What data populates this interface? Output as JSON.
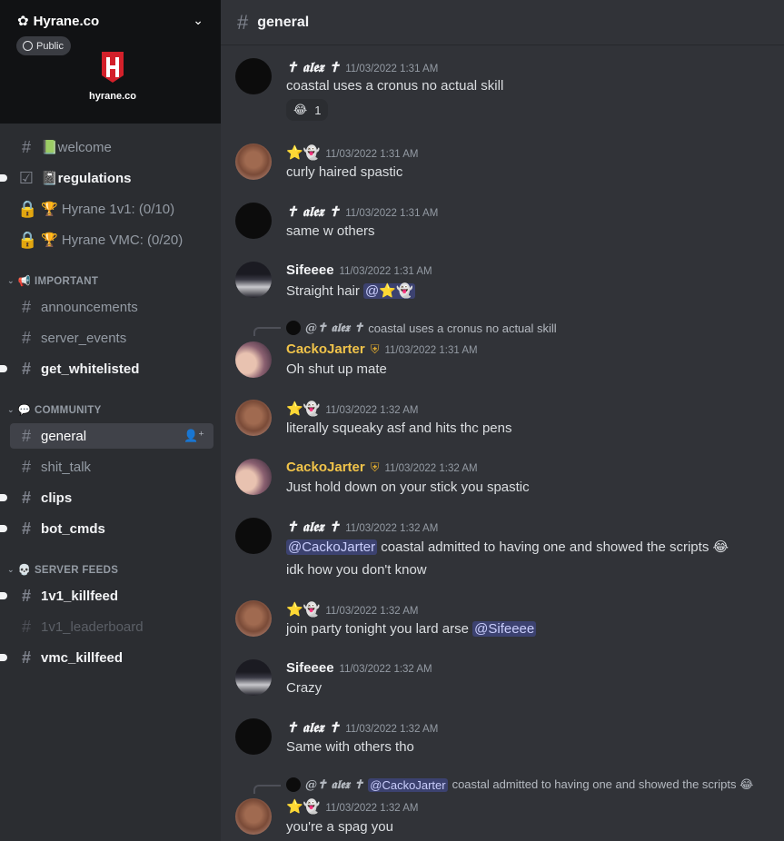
{
  "server": {
    "name": "Hyrane.co",
    "public_label": "Public",
    "logo_text": "hyrane.co"
  },
  "channels_top": [
    {
      "label": "📗welcome",
      "icon": "hash-icon"
    },
    {
      "label": "📓regulations",
      "icon": "rules-icon"
    },
    {
      "label": "🏆 Hyrane 1v1: (0/10)",
      "icon": "lock-icon"
    },
    {
      "label": "🏆 Hyrane VMC: (0/20)",
      "icon": "lock-icon"
    }
  ],
  "categories": {
    "important": "📢 IMPORTANT",
    "community": "💬 COMMUNITY",
    "server_feeds": "💀 SERVER FEEDS"
  },
  "channels_important": [
    "announcements",
    "server_events",
    "get_whitelisted"
  ],
  "channels_community": [
    "general",
    "shit_talk",
    "clips",
    "bot_cmds"
  ],
  "channels_feeds": [
    "1v1_killfeed",
    "1v1_leaderboard",
    "vmc_killfeed"
  ],
  "header": {
    "channel": "general"
  },
  "messages": [
    {
      "user": "✝ 𝖆𝖑𝖊𝖝 ✝",
      "time": "11/03/2022 1:31 AM",
      "text": "coastal uses a cronus no actual skill",
      "reaction_emoji": "😂",
      "reaction_count": "1"
    },
    {
      "user": "⭐👻",
      "time": "11/03/2022 1:31 AM",
      "text": "curly haired spastic"
    },
    {
      "user": "✝ 𝖆𝖑𝖊𝖝 ✝",
      "time": "11/03/2022 1:31 AM",
      "text": "same w others"
    },
    {
      "user": "Sifeeee",
      "time": "11/03/2022 1:31 AM",
      "text": "Straight hair ",
      "mention": "@⭐👻"
    },
    {
      "reply_user": "@✝ 𝖆𝖑𝖊𝖝 ✝",
      "reply_text": "coastal uses a cronus no actual skill",
      "user": "CackoJarter",
      "time": "11/03/2022 1:31 AM",
      "text": "Oh shut up mate"
    },
    {
      "user": "⭐👻",
      "time": "11/03/2022 1:32 AM",
      "text": "literally squeaky asf and hits thc pens"
    },
    {
      "user": "CackoJarter",
      "time": "11/03/2022 1:32 AM",
      "text": "Just hold down on your stick you spastic"
    },
    {
      "user": "✝ 𝖆𝖑𝖊𝖝 ✝",
      "time": "11/03/2022 1:32 AM",
      "mention": "@CackoJarter",
      "text": " coastal admitted to having one and showed the scripts 😂",
      "text2": "idk how you don't know"
    },
    {
      "user": "⭐👻",
      "time": "11/03/2022 1:32 AM",
      "text": "join party tonight you lard arse ",
      "mention": "@Sifeeee"
    },
    {
      "user": "Sifeeee",
      "time": "11/03/2022 1:32 AM",
      "text": "Crazy"
    },
    {
      "user": "✝ 𝖆𝖑𝖊𝖝 ✝",
      "time": "11/03/2022 1:32 AM",
      "text": "Same with others tho"
    },
    {
      "reply_user": "@✝ 𝖆𝖑𝖊𝖝 ✝",
      "reply_mention": "@CackoJarter",
      "reply_text": "coastal admitted to having one and showed the scripts 😂",
      "user": "⭐👻",
      "time": "11/03/2022 1:32 AM",
      "text": "you're a spag you"
    }
  ],
  "colors": {
    "accent_gold": "#f0c34a",
    "mention_bg": "#3c4270",
    "sidebar_bg": "#2b2d31",
    "chat_bg": "#313338"
  }
}
